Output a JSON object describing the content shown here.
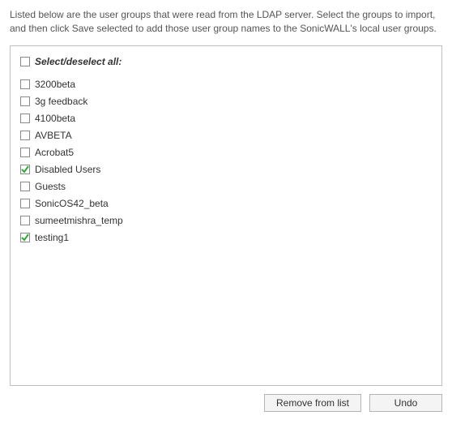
{
  "intro": "Listed below are the user groups that were read from the LDAP server. Select the groups to import, and then click Save selected to add those user group names to the SonicWALL's local user groups.",
  "select_all": {
    "label": "Select/deselect all:",
    "checked": false
  },
  "groups": [
    {
      "label": "3200beta",
      "checked": false
    },
    {
      "label": "3g feedback",
      "checked": false
    },
    {
      "label": "4100beta",
      "checked": false
    },
    {
      "label": "AVBETA",
      "checked": false
    },
    {
      "label": "Acrobat5",
      "checked": false
    },
    {
      "label": "Disabled Users",
      "checked": true
    },
    {
      "label": "Guests",
      "checked": false
    },
    {
      "label": "SonicOS42_beta",
      "checked": false
    },
    {
      "label": "sumeetmishra_temp",
      "checked": false
    },
    {
      "label": "testing1",
      "checked": true
    }
  ],
  "buttons": {
    "remove": "Remove from list",
    "undo": "Undo"
  },
  "colors": {
    "check": "#2fa837"
  }
}
